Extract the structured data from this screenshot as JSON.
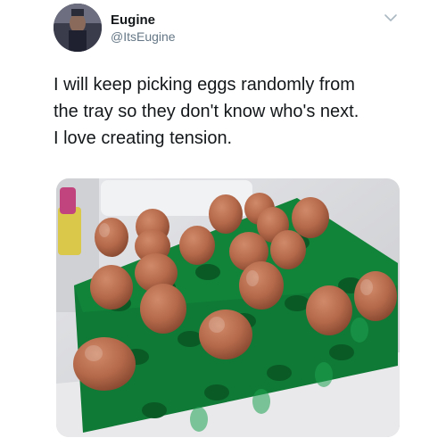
{
  "tweet": {
    "author": {
      "display_name": "Eugine",
      "handle": "@ItsEugine",
      "avatar_icon": "profile-avatar"
    },
    "menu_icon": "chevron-down-icon",
    "text_lines": [
      "I will keep picking eggs randomly from",
      "the tray so they don't know who's next.",
      "I love creating tension."
    ],
    "media": {
      "icon": "egg-tray-photo",
      "colors": {
        "tray": "#0f7a35",
        "egg": "#b4694a",
        "background": "#d9dadc"
      }
    }
  }
}
